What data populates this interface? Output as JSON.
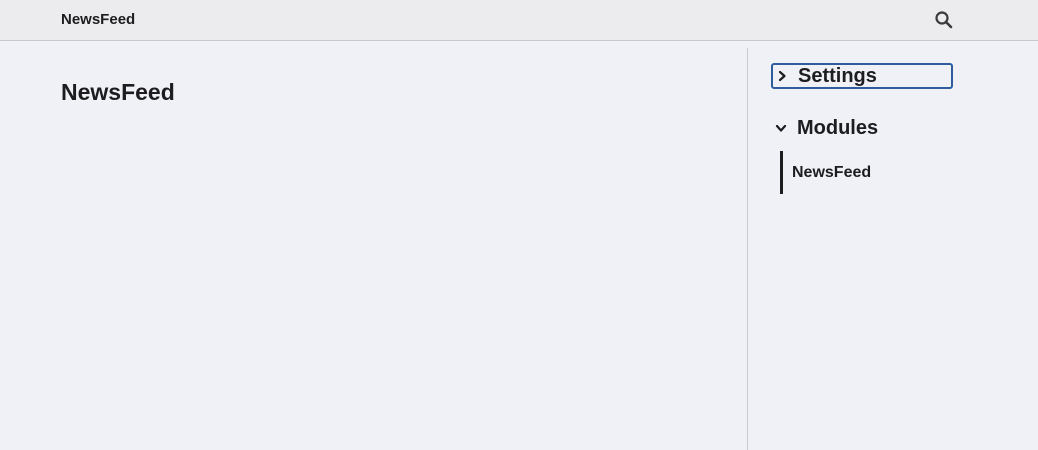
{
  "header": {
    "title": "NewsFeed",
    "search_icon": "search-icon"
  },
  "main": {
    "page_title": "NewsFeed"
  },
  "sidebar": {
    "sections": [
      {
        "label": "Settings",
        "expanded": false,
        "focused": true,
        "icon": "chevron-right-icon"
      },
      {
        "label": "Modules",
        "expanded": true,
        "icon": "chevron-down-icon",
        "items": [
          {
            "label": "NewsFeed"
          }
        ]
      }
    ]
  },
  "colors": {
    "background": "#eff1f7",
    "topbar": "#ececee",
    "focus_ring": "#2d5d9c",
    "text": "#1d1d1f"
  }
}
